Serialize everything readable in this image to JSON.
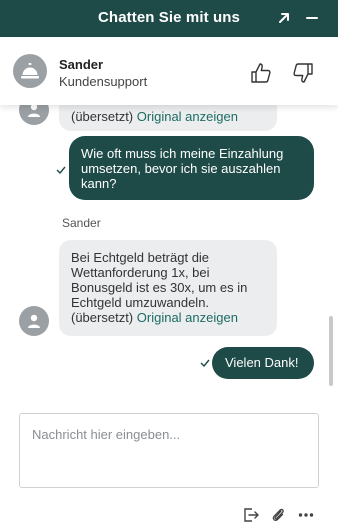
{
  "header": {
    "title": "Chatten Sie mit uns",
    "expand_icon": "arrow-up-right-icon",
    "minimize_icon": "minus-icon",
    "background": "#1e4a47"
  },
  "agent": {
    "name": "Sander",
    "role": "Kundensupport",
    "avatar_icon": "service-bell-icon",
    "thumbs_up_icon": "thumbs-up-icon",
    "thumbs_down_icon": "thumbs-down-icon"
  },
  "messages": [
    {
      "from": "agent",
      "translated_tag": "(übersetzt)",
      "original_link": "Original anzeigen"
    },
    {
      "from": "user",
      "lines": [
        "Wie oft muss ich meine Einzahlung",
        "umsetzen, bevor ich sie auszahlen",
        "kann?"
      ],
      "status_icon": "checkmark-icon"
    },
    {
      "from": "agent",
      "sender": "Sander",
      "lines": [
        "Bei Echtgeld beträgt die",
        "Wettanforderung 1x, bei",
        "Bonusgeld ist es 30x, um es in",
        "Echtgeld umzuwandeln."
      ],
      "translated_tag": "(übersetzt)",
      "original_link": "Original anzeigen"
    },
    {
      "from": "user",
      "lines": [
        "Vielen Dank!"
      ],
      "status_icon": "checkmark-icon"
    }
  ],
  "composer": {
    "placeholder": "Nachricht hier eingeben..."
  },
  "toolbar": {
    "icons": [
      "end-chat-icon",
      "paperclip-icon",
      "more-icon"
    ]
  },
  "colors": {
    "accent": "#1e4a47",
    "incoming_bubble": "#ebedef",
    "link": "#1e6b63"
  }
}
